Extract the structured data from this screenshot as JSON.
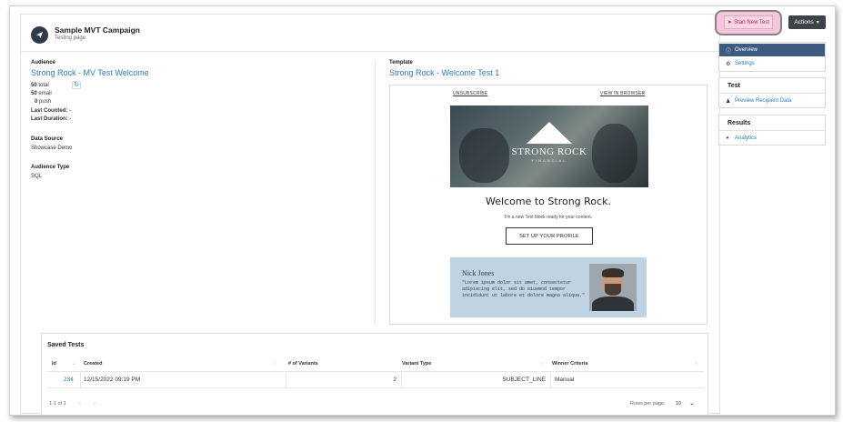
{
  "header": {
    "title": "Sample MVT Campaign",
    "subtitle": "Testing page"
  },
  "audience": {
    "label": "Audience",
    "name": "Strong Rock - MV Test Welcome",
    "total_value": "50",
    "total_suffix": "total",
    "email_value": "50",
    "email_suffix": "email",
    "push_value": "0",
    "push_suffix": "push",
    "last_counted_label": "Last Counted:",
    "last_counted_value": "-",
    "last_duration_label": "Last Duration:",
    "last_duration_value": "-",
    "data_source_label": "Data Source",
    "data_source_value": "Showcase Demo",
    "audience_type_label": "Audience Type",
    "audience_type_value": "SQL"
  },
  "template": {
    "label": "Template",
    "name": "Strong Rock - Welcome Test 1",
    "unsubscribe": "UNSUBSCRIBE",
    "view_in_browser": "VIEW IN BROWSER",
    "brand_name": "STRONG ROCK",
    "brand_sub": "FINANCIAL",
    "heading": "Welcome to Strong Rock.",
    "body_text": "I'm a new Text block ready for your content.",
    "cta": "SET UP YOUR PROFILE",
    "signature_name": "Nick Jones",
    "signature_text": "\"Lorem ipsum dolor sit amet, consectetur adipiscing elit, sed do eiusmod tempor incididunt ut labore et dolore magna aliqua.\""
  },
  "saved_tests": {
    "title": "Saved Tests",
    "columns": {
      "id": "Id",
      "created": "Created",
      "variants": "# of Variants",
      "variant_type": "Variant Type",
      "winner": "Winner Criteria"
    },
    "rows": [
      {
        "id": "234",
        "created": "12/15/2022 09:19 PM",
        "variants": "2",
        "variant_type": "SUBJECT_LINE",
        "winner": "Manual"
      }
    ],
    "pagination": "1-1 of 1",
    "rows_per_page_label": "Rows per page:",
    "rows_per_page_value": "10"
  },
  "toolbar": {
    "start_new_test": "Start New Test",
    "actions": "Actions"
  },
  "sidebar": {
    "overview": "Overview",
    "settings": "Settings",
    "test_header": "Test",
    "preview_recipient_data": "Preview Recipient Data",
    "results_header": "Results",
    "analytics": "Analytics"
  },
  "colors": {
    "accent": "#2b7bb9",
    "active_nav": "#3d5a80",
    "start_button_bg": "#f7d6e6",
    "start_button_text": "#c2185b",
    "actions_bg": "#3e4249"
  },
  "icons": {
    "campaign": "paper-plane-icon",
    "refresh": "refresh-icon",
    "start_test": "paper-plane-icon",
    "overview": "info-circle-icon",
    "settings": "gear-icon",
    "preview": "users-icon",
    "analytics": "pie-chart-icon"
  }
}
